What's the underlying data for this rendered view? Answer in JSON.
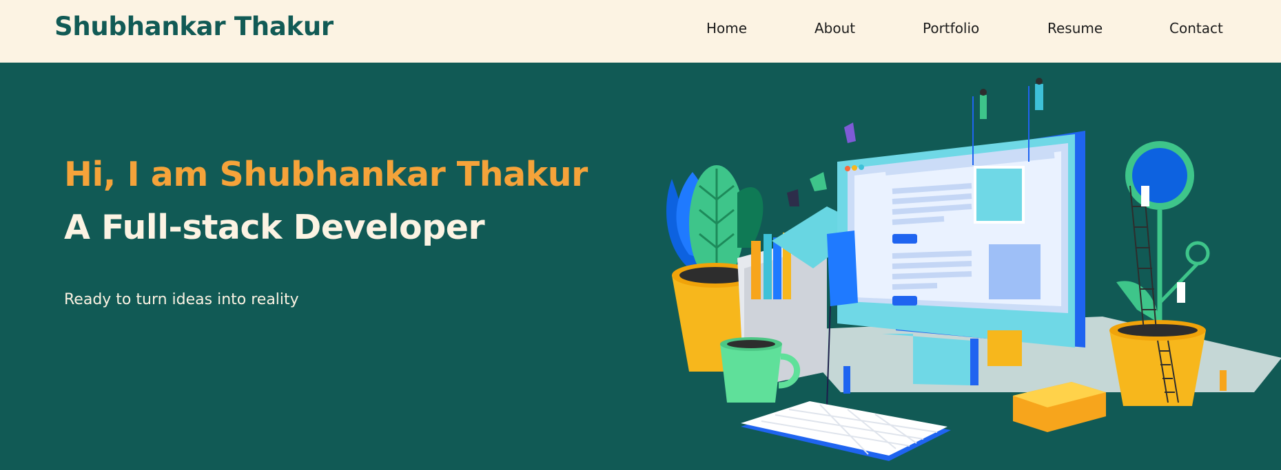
{
  "navbar": {
    "brand": "Shubhankar Thakur",
    "links": [
      "Home",
      "About",
      "Portfolio",
      "Resume",
      "Contact"
    ]
  },
  "hero": {
    "greeting": "Hi, I am Shubhankar Thakur",
    "role": "A Full-stack Developer",
    "tagline": "Ready to turn ideas into reality"
  },
  "colors": {
    "nav_bg": "#fcf3e3",
    "hero_bg": "#115a55",
    "accent_orange": "#f5a33a",
    "text_light": "#fcf3e3"
  },
  "illustration": "developer-workspace-illustration"
}
